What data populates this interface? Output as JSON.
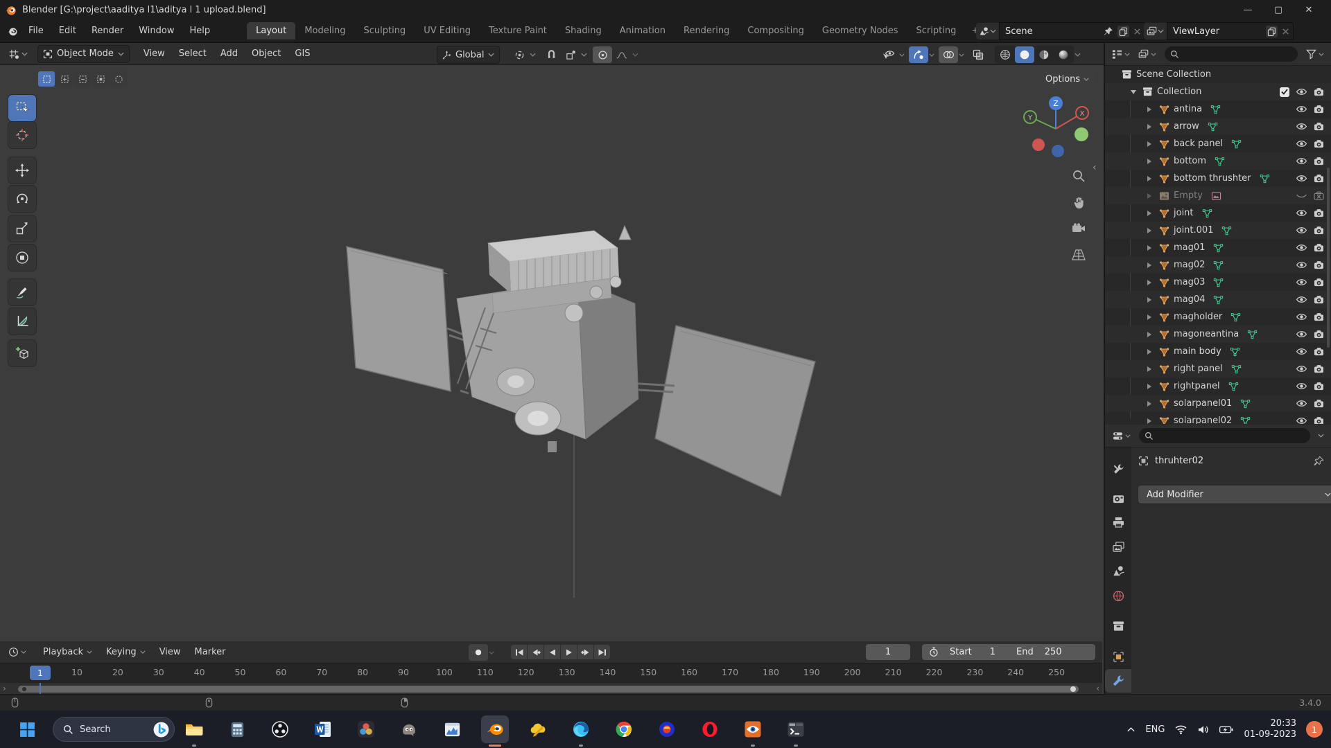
{
  "window": {
    "title": "Blender [G:\\project\\aaditya l1\\aditya l 1 upload.blend]",
    "controls": [
      "minimize",
      "maximize",
      "close"
    ]
  },
  "topbar": {
    "menus": [
      {
        "label": "File"
      },
      {
        "label": "Edit"
      },
      {
        "label": "Render"
      },
      {
        "label": "Window"
      },
      {
        "label": "Help"
      }
    ],
    "workspaces": [
      {
        "label": "Layout",
        "active": true
      },
      {
        "label": "Modeling"
      },
      {
        "label": "Sculpting"
      },
      {
        "label": "UV Editing"
      },
      {
        "label": "Texture Paint"
      },
      {
        "label": "Shading"
      },
      {
        "label": "Animation"
      },
      {
        "label": "Rendering"
      },
      {
        "label": "Compositing"
      },
      {
        "label": "Geometry Nodes"
      },
      {
        "label": "Scripting"
      },
      {
        "label": "+",
        "add": true
      }
    ],
    "scene": {
      "value": "Scene"
    },
    "view_layer": {
      "value": "ViewLayer"
    }
  },
  "tool_header": {
    "mode": "Object Mode",
    "menus": [
      {
        "label": "View"
      },
      {
        "label": "Select"
      },
      {
        "label": "Add"
      },
      {
        "label": "Object"
      },
      {
        "label": "GIS"
      }
    ],
    "orientation": "Global",
    "right_toggles": [
      {
        "name": "visibility",
        "dropdown": true
      },
      {
        "name": "gizmos",
        "active": true,
        "dropdown": true
      },
      {
        "name": "overlays",
        "pressed": true,
        "dropdown": true
      },
      {
        "name": "xray",
        "dropdown": false
      }
    ],
    "shading_modes": [
      {
        "name": "wireframe"
      },
      {
        "name": "solid",
        "active": true
      },
      {
        "name": "material-preview"
      },
      {
        "name": "rendered"
      }
    ]
  },
  "viewport": {
    "options_label": "Options",
    "active_tool": "select-box",
    "tools": [
      "select-box",
      "cursor",
      "move",
      "rotate",
      "scale",
      "transform",
      "annotate",
      "measure",
      "add-cube"
    ],
    "select_modes": [
      "set",
      "extend",
      "subtract",
      "invert",
      "intersect"
    ],
    "gizmo_axes": {
      "x": "X",
      "y": "Y",
      "z": "Z"
    },
    "nav_buttons": [
      "zoom",
      "pan",
      "camera",
      "grid"
    ]
  },
  "outliner": {
    "rows": [
      {
        "name": "Scene Collection",
        "type": "scene_collection",
        "level": 0
      },
      {
        "name": "Collection",
        "type": "collection",
        "level": 1,
        "expanded": true,
        "checked": true
      },
      {
        "name": "antina",
        "type": "mesh",
        "level": 2
      },
      {
        "name": "arrow",
        "type": "mesh",
        "level": 2
      },
      {
        "name": "back panel",
        "type": "mesh",
        "level": 2
      },
      {
        "name": "bottom",
        "type": "mesh",
        "level": 2
      },
      {
        "name": "bottom thrushter",
        "type": "mesh",
        "level": 2
      },
      {
        "name": "Empty",
        "type": "empty",
        "level": 2,
        "muted": true
      },
      {
        "name": "joint",
        "type": "mesh",
        "level": 2
      },
      {
        "name": "joint.001",
        "type": "mesh",
        "level": 2
      },
      {
        "name": "mag01",
        "type": "mesh",
        "level": 2
      },
      {
        "name": "mag02",
        "type": "mesh",
        "level": 2
      },
      {
        "name": "mag03",
        "type": "mesh",
        "level": 2
      },
      {
        "name": "mag04",
        "type": "mesh",
        "level": 2
      },
      {
        "name": "magholder",
        "type": "mesh",
        "level": 2
      },
      {
        "name": "magoneantina",
        "type": "mesh",
        "level": 2
      },
      {
        "name": "main body",
        "type": "mesh",
        "level": 2
      },
      {
        "name": "right panel",
        "type": "mesh",
        "level": 2
      },
      {
        "name": "rightpanel",
        "type": "mesh",
        "level": 2
      },
      {
        "name": "solarpanel01",
        "type": "mesh",
        "level": 2
      },
      {
        "name": "solarpanel02",
        "type": "mesh",
        "level": 2
      }
    ]
  },
  "properties": {
    "tabs": [
      "tool",
      "render",
      "output",
      "view-layer",
      "scene",
      "world",
      "collection",
      "object",
      "modifier"
    ],
    "active_tab": "modifier",
    "object_name": "thruhter02",
    "add_modifier_label": "Add Modifier"
  },
  "timeline": {
    "menus": [
      {
        "label": "Playback",
        "dropdown": true
      },
      {
        "label": "Keying",
        "dropdown": true
      },
      {
        "label": "View"
      },
      {
        "label": "Marker"
      }
    ],
    "playback_buttons": [
      "jump-to-start",
      "previous-keyframe",
      "play-reverse",
      "play",
      "next-keyframe",
      "jump-to-end"
    ],
    "current_frame": "1",
    "frame_first": 1,
    "frame_last": 250,
    "tick_step": 10,
    "start_label": "Start",
    "start_value": "1",
    "end_label": "End",
    "end_value": "250"
  },
  "status_bar": {
    "version": "3.4.0"
  },
  "taskbar": {
    "search_label": "Search",
    "apps": [
      {
        "name": "file-explorer",
        "running": true
      },
      {
        "name": "calculator"
      },
      {
        "name": "obs-studio"
      },
      {
        "name": "word"
      },
      {
        "name": "davinci-resolve"
      },
      {
        "name": "gimp"
      },
      {
        "name": "task-manager"
      },
      {
        "name": "blender",
        "active": true
      },
      {
        "name": "sketchbook"
      },
      {
        "name": "edge",
        "running": true
      },
      {
        "name": "chrome"
      },
      {
        "name": "media-app"
      },
      {
        "name": "opera"
      },
      {
        "name": "faststone",
        "running": true
      },
      {
        "name": "terminal",
        "running": true
      }
    ],
    "tray": {
      "language": "ENG",
      "time": "20:33",
      "date": "01-09-2023",
      "badge": "1"
    }
  },
  "colors": {
    "accent_blue": "#4f76b8",
    "mesh_orange": "#cf8c45",
    "data_green": "#49d69a",
    "taskbar_badge": "#e8734a"
  }
}
